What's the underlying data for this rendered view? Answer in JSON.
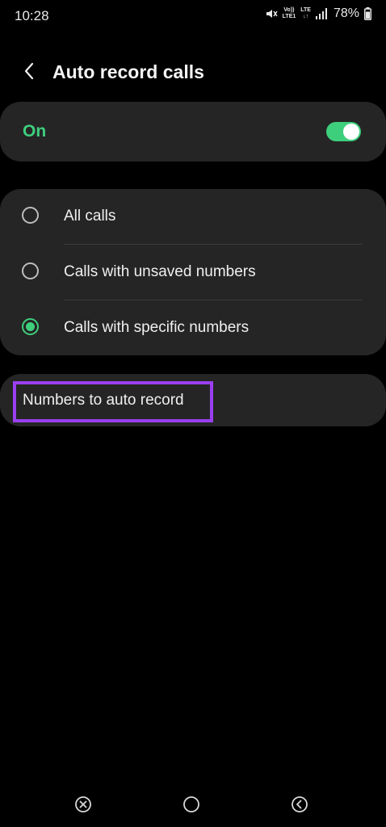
{
  "status_bar": {
    "time": "10:28",
    "net_label_top": "Vo))",
    "net_label_bottom": "LTE1",
    "lte_label": "LTE",
    "battery": "78%",
    "icons": [
      "mute-icon",
      "volte-icon",
      "lte-icon",
      "signal-icon",
      "battery-icon"
    ]
  },
  "header": {
    "title": "Auto record calls",
    "back_icon": "chevron-left-icon"
  },
  "master_switch": {
    "label": "On",
    "enabled": true,
    "accent": "#3ecf7d"
  },
  "options": [
    {
      "label": "All calls",
      "selected": false
    },
    {
      "label": "Calls with unsaved numbers",
      "selected": false
    },
    {
      "label": "Calls with specific numbers",
      "selected": true
    }
  ],
  "numbers_item": {
    "label": "Numbers to auto record",
    "highlight_color": "#9a3ff0"
  },
  "nav_bar": {
    "icons": [
      "recent-apps-icon",
      "home-icon",
      "back-icon"
    ]
  },
  "colors": {
    "background": "#000000",
    "card": "#252525",
    "accent": "#3ecf7d"
  }
}
